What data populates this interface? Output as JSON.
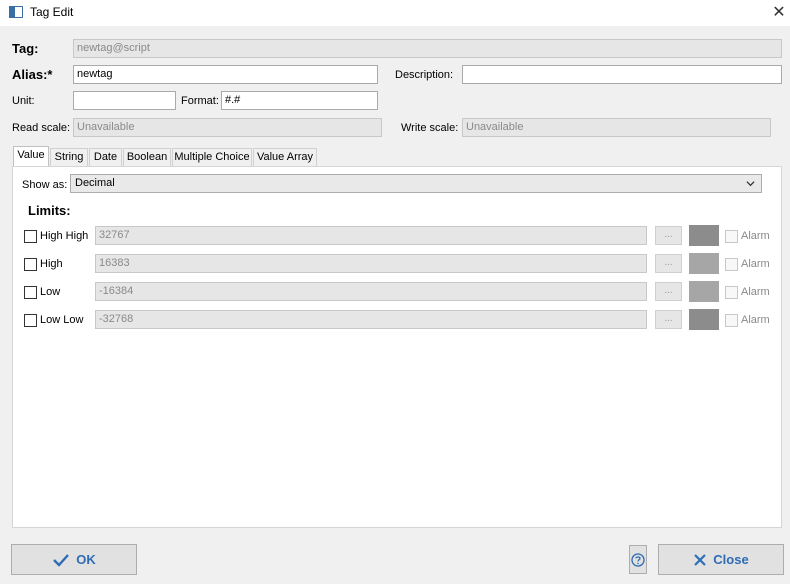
{
  "window": {
    "title": "Tag Edit",
    "close_glyph": "✕"
  },
  "form": {
    "tag_label": "Tag:",
    "tag_value": "newtag@script",
    "alias_label": "Alias:*",
    "alias_value": "newtag",
    "description_label": "Description:",
    "description_value": "",
    "unit_label": "Unit:",
    "unit_value": "",
    "format_label": "Format:",
    "format_value": "#.#",
    "read_scale_label": "Read scale:",
    "read_scale_value": "Unavailable",
    "write_scale_label": "Write scale:",
    "write_scale_value": "Unavailable"
  },
  "tabs": [
    {
      "label": "Value",
      "active": true
    },
    {
      "label": "String"
    },
    {
      "label": "Date"
    },
    {
      "label": "Boolean"
    },
    {
      "label": "Multiple Choice"
    },
    {
      "label": "Value Array"
    }
  ],
  "value_tab": {
    "show_as_label": "Show as:",
    "show_as_value": "Decimal",
    "limits_label": "Limits:",
    "limits": [
      {
        "label": "High High",
        "value": "32767",
        "checked": false,
        "dots": "...",
        "alarm_label": "Alarm",
        "color": "#8c8c8c"
      },
      {
        "label": "High",
        "value": "16383",
        "checked": false,
        "dots": "...",
        "alarm_label": "Alarm",
        "color": "#a6a6a6"
      },
      {
        "label": "Low",
        "value": "-16384",
        "checked": false,
        "dots": "...",
        "alarm_label": "Alarm",
        "color": "#a6a6a6"
      },
      {
        "label": "Low Low",
        "value": "-32768",
        "checked": false,
        "dots": "...",
        "alarm_label": "Alarm",
        "color": "#8c8c8c"
      }
    ]
  },
  "buttons": {
    "ok_label": "OK",
    "close_label": "Close"
  },
  "colors": {
    "accent": "#2e6cb5",
    "help": "#2e6cb5"
  },
  "icons": {
    "ok": "checkmark-icon",
    "close": "x-icon",
    "help": "help-icon"
  }
}
